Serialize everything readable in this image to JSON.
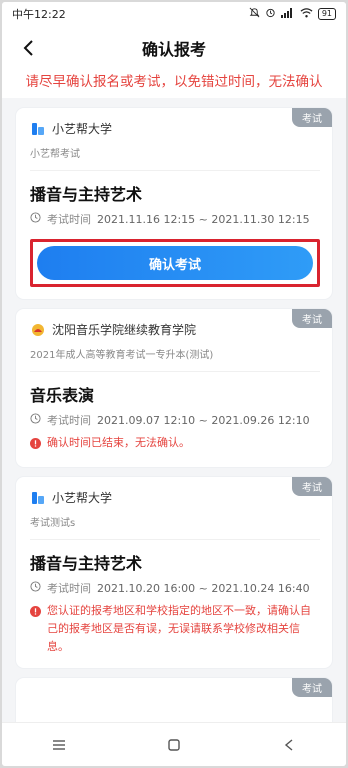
{
  "status": {
    "time": "中午12:22",
    "battery": "91"
  },
  "header": {
    "title": "确认报考"
  },
  "banner": "请尽早确认报名或考试，以免错过时间，无法确认",
  "cards": [
    {
      "tag": "考试",
      "org": "小艺帮大学",
      "subtitle": "小艺帮考试",
      "exam_name": "播音与主持艺术",
      "time_label": "考试时间",
      "time_value": "2021.11.16 12:15 ~ 2021.11.30 12:15",
      "button": "确认考试"
    },
    {
      "tag": "考试",
      "org": "沈阳音乐学院继续教育学院",
      "subtitle": "2021年成人高等教育考试一专升本(测试)",
      "exam_name": "音乐表演",
      "time_label": "考试时间",
      "time_value": "2021.09.07 12:10 ~ 2021.09.26 12:10",
      "warning": "确认时间已结束，无法确认。"
    },
    {
      "tag": "考试",
      "org": "小艺帮大学",
      "subtitle": "考试测试s",
      "exam_name": "播音与主持艺术",
      "time_label": "考试时间",
      "time_value": "2021.10.20 16:00 ~ 2021.10.24 16:40",
      "warning": "您认证的报考地区和学校指定的地区不一致，请确认自己的报考地区是否有误，无误请联系学校修改相关信息。"
    },
    {
      "tag": "考试"
    }
  ],
  "colors": {
    "accent": "#1e7ef0",
    "warning": "#e5443f",
    "tag": "#9aa3ad",
    "highlight": "#d9232f"
  }
}
